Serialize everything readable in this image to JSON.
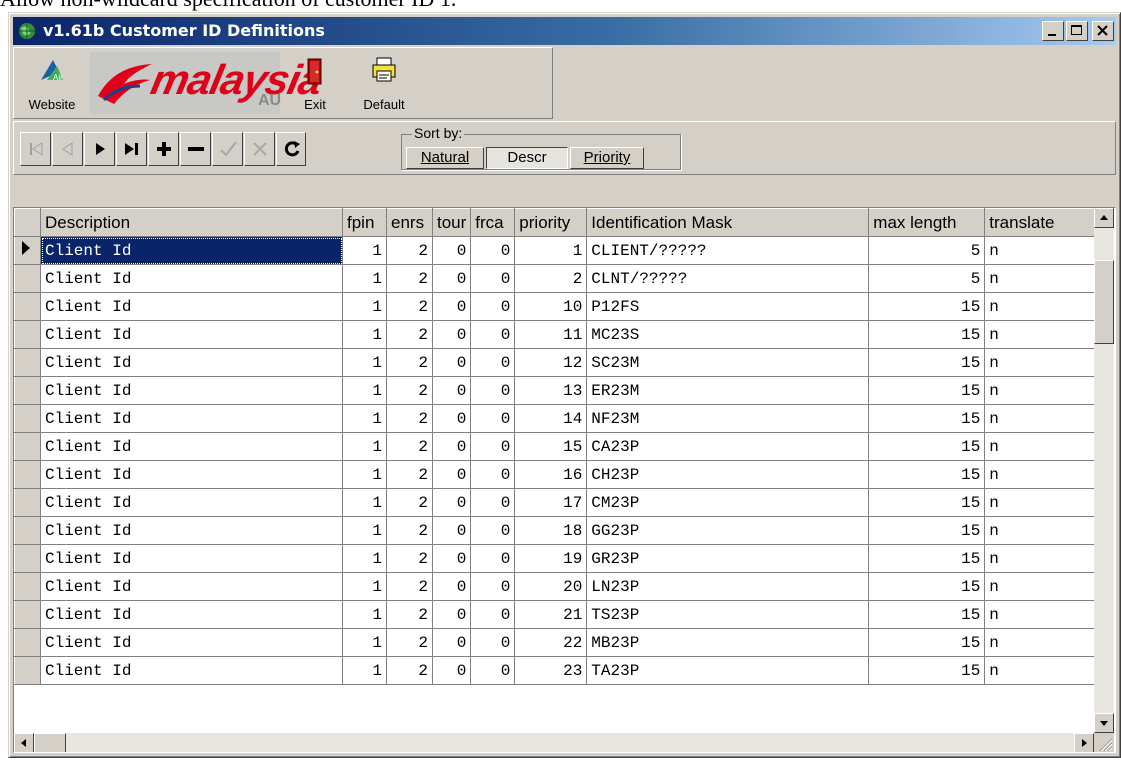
{
  "caption_text": "Allow non-wildcard specification of customer ID 1.",
  "window": {
    "title": "v1.61b Customer ID Definitions",
    "controls": [
      "minimize",
      "maximize",
      "close"
    ]
  },
  "toolbar": {
    "website_label": "Website",
    "logo_text": "malaysia",
    "logo_suffix": "AU",
    "exit_label": "Exit",
    "default_label": "Default"
  },
  "navigator": {
    "buttons": [
      "first",
      "prior",
      "next",
      "last",
      "insert",
      "delete",
      "post",
      "cancel",
      "refresh"
    ]
  },
  "sort": {
    "legend": "Sort by:",
    "options": [
      "Natural",
      "Descr",
      "Priority"
    ],
    "selected": "Descr"
  },
  "grid": {
    "columns": [
      "Description",
      "fpin",
      "enrs",
      "tour",
      "frca",
      "priority",
      "Identification Mask",
      "max length",
      "translate"
    ],
    "rows": [
      [
        "Client Id",
        "1",
        "2",
        "0",
        "0",
        "1",
        "CLIENT/?????",
        "5",
        "n"
      ],
      [
        "Client Id",
        "1",
        "2",
        "0",
        "0",
        "2",
        "CLNT/?????",
        "5",
        "n"
      ],
      [
        "Client Id",
        "1",
        "2",
        "0",
        "0",
        "10",
        "P12FS",
        "15",
        "n"
      ],
      [
        "Client Id",
        "1",
        "2",
        "0",
        "0",
        "11",
        "MC23S",
        "15",
        "n"
      ],
      [
        "Client Id",
        "1",
        "2",
        "0",
        "0",
        "12",
        "SC23M",
        "15",
        "n"
      ],
      [
        "Client Id",
        "1",
        "2",
        "0",
        "0",
        "13",
        "ER23M",
        "15",
        "n"
      ],
      [
        "Client Id",
        "1",
        "2",
        "0",
        "0",
        "14",
        "NF23M",
        "15",
        "n"
      ],
      [
        "Client Id",
        "1",
        "2",
        "0",
        "0",
        "15",
        "CA23P",
        "15",
        "n"
      ],
      [
        "Client Id",
        "1",
        "2",
        "0",
        "0",
        "16",
        "CH23P",
        "15",
        "n"
      ],
      [
        "Client Id",
        "1",
        "2",
        "0",
        "0",
        "17",
        "CM23P",
        "15",
        "n"
      ],
      [
        "Client Id",
        "1",
        "2",
        "0",
        "0",
        "18",
        "GG23P",
        "15",
        "n"
      ],
      [
        "Client Id",
        "1",
        "2",
        "0",
        "0",
        "19",
        "GR23P",
        "15",
        "n"
      ],
      [
        "Client Id",
        "1",
        "2",
        "0",
        "0",
        "20",
        "LN23P",
        "15",
        "n"
      ],
      [
        "Client Id",
        "1",
        "2",
        "0",
        "0",
        "21",
        "TS23P",
        "15",
        "n"
      ],
      [
        "Client Id",
        "1",
        "2",
        "0",
        "0",
        "22",
        "MB23P",
        "15",
        "n"
      ],
      [
        "Client Id",
        "1",
        "2",
        "0",
        "0",
        "23",
        "TA23P",
        "15",
        "n"
      ]
    ],
    "selected_row": 0
  },
  "colors": {
    "titlebar_start": "#0a246a",
    "titlebar_end": "#a6caf0",
    "face": "#d4d0c8",
    "selection": "#0a246a",
    "logo_red": "#e1001a"
  }
}
